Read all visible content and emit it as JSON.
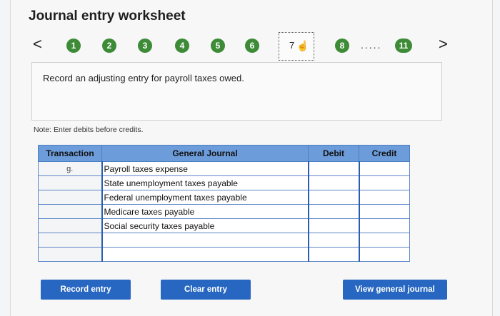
{
  "header": {
    "title": "Journal entry worksheet"
  },
  "stepper": {
    "prev": "<",
    "next": ">",
    "steps": [
      "1",
      "2",
      "3",
      "4",
      "5",
      "6"
    ],
    "current": "7",
    "step8": "8",
    "ellipsis": ".....",
    "last": "11",
    "step_color": "#3d8b37"
  },
  "prompt": {
    "text": "Record an adjusting entry for payroll taxes owed."
  },
  "note": "Note: Enter debits before credits.",
  "table": {
    "headers": {
      "transaction": "Transaction",
      "general_journal": "General Journal",
      "debit": "Debit",
      "credit": "Credit"
    },
    "rows": [
      {
        "transaction": "g.",
        "account": "Payroll taxes expense",
        "debit": "",
        "credit": ""
      },
      {
        "transaction": "",
        "account": "State unemployment taxes payable",
        "debit": "",
        "credit": ""
      },
      {
        "transaction": "",
        "account": "Federal unemployment taxes payable",
        "debit": "",
        "credit": ""
      },
      {
        "transaction": "",
        "account": "Medicare taxes payable",
        "debit": "",
        "credit": ""
      },
      {
        "transaction": "",
        "account": "Social security taxes payable",
        "debit": "",
        "credit": ""
      },
      {
        "transaction": "",
        "account": "",
        "debit": "",
        "credit": ""
      },
      {
        "transaction": "",
        "account": "",
        "debit": "",
        "credit": ""
      }
    ],
    "header_color": "#6d9cdb"
  },
  "buttons": {
    "record": "Record entry",
    "clear": "Clear entry",
    "view": "View general journal",
    "color": "#2767c1"
  }
}
